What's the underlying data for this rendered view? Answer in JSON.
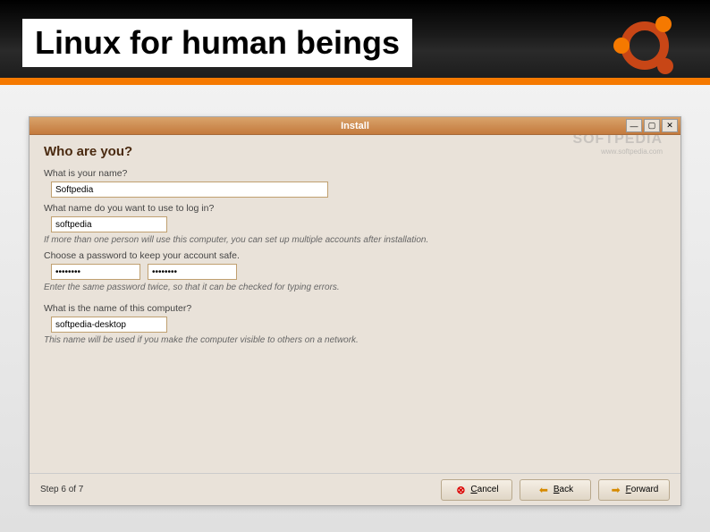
{
  "slide": {
    "title": "Linux for human beings"
  },
  "window": {
    "title": "Install",
    "watermark": "SOFTPEDIA",
    "watermark_sub": "www.softpedia.com",
    "heading": "Who are you?",
    "name_label": "What is your name?",
    "name_value": "Softpedia",
    "login_label": "What name do you want to use to log in?",
    "login_value": "softpedia",
    "login_hint": "If more than one person will use this computer, you can set up multiple accounts after installation.",
    "password_label": "Choose a password to keep your account safe.",
    "password_value": "********",
    "password_confirm_value": "********",
    "password_hint": "Enter the same password twice, so that it can be checked for typing errors.",
    "computer_label": "What is the name of this computer?",
    "computer_value": "softpedia-desktop",
    "computer_hint": "This name will be used if you make the computer visible to others on a network."
  },
  "footer": {
    "step": "Step 6 of 7",
    "cancel": "Cancel",
    "back": "Back",
    "forward": "Forward"
  }
}
